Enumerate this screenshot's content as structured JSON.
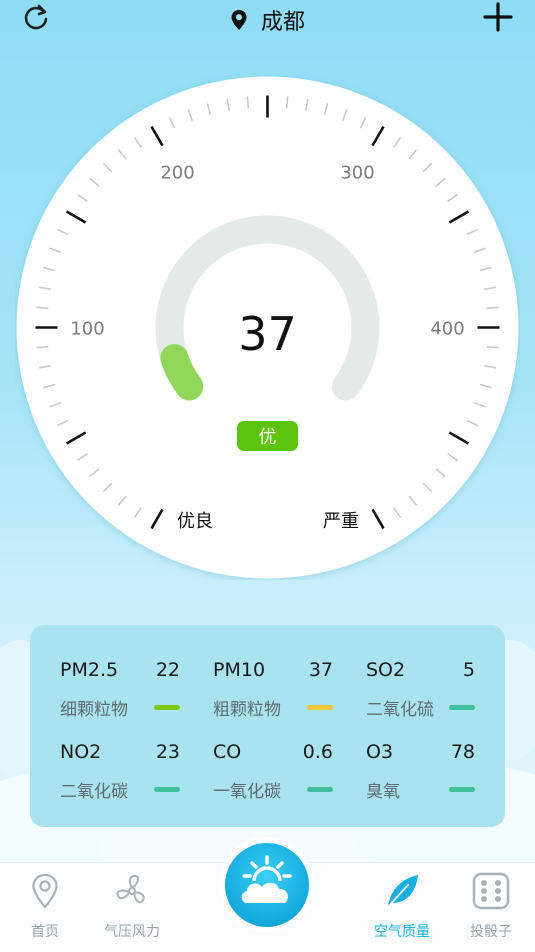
{
  "header": {
    "city": "成都"
  },
  "gauge": {
    "value": "37",
    "level_badge": "优",
    "scale_labels": [
      "100",
      "200",
      "300",
      "400"
    ],
    "left_text": "优良",
    "right_text": "严重",
    "aqi_fraction": 0.074,
    "badge_color": "#5cc40c",
    "arc_color": "#8fd85a",
    "track_color": "#e4ebe6"
  },
  "pollutants": [
    {
      "name": "PM2.5",
      "value": "22",
      "desc": "细颗粒物",
      "bar_color": "#7ec80f"
    },
    {
      "name": "PM10",
      "value": "37",
      "desc": "粗颗粒物",
      "bar_color": "#f0c93c"
    },
    {
      "name": "SO2",
      "value": "5",
      "desc": "二氧化硫",
      "bar_color": "#3fc19c"
    },
    {
      "name": "NO2",
      "value": "23",
      "desc": "二氧化碳",
      "bar_color": "#3fc19c"
    },
    {
      "name": "CO",
      "value": "0.6",
      "desc": "一氧化碳",
      "bar_color": "#3fc19c"
    },
    {
      "name": "O3",
      "value": "78",
      "desc": "臭氧",
      "bar_color": "#3fc19c"
    }
  ],
  "tabs": [
    {
      "label": "首页",
      "icon": "location-pin-icon"
    },
    {
      "label": "气压风力",
      "icon": "fan-icon"
    },
    {
      "label": "空气质量",
      "icon": "leaf-icon",
      "active": true
    },
    {
      "label": "投骰子",
      "icon": "dice-icon"
    }
  ],
  "center_button": {
    "icon": "sun-cloud-icon"
  }
}
